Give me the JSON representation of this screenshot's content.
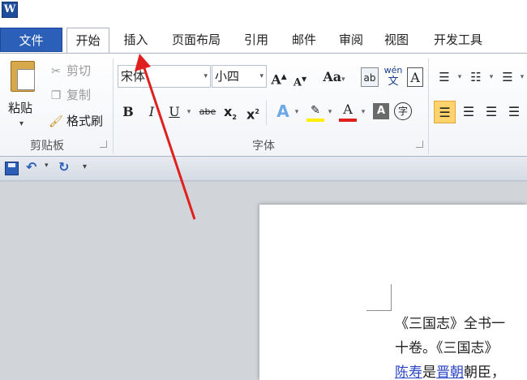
{
  "app": {
    "logo_text": "W"
  },
  "tabs": {
    "file": "文件",
    "items": [
      "开始",
      "插入",
      "页面布局",
      "引用",
      "邮件",
      "审阅",
      "视图",
      "开发工具"
    ]
  },
  "clipboard": {
    "paste": "粘贴",
    "cut": "剪切",
    "copy": "复制",
    "format_painter": "格式刷",
    "group_label": "剪贴板"
  },
  "font": {
    "name": "宋体",
    "size": "小四",
    "grow": "A",
    "shrink": "A",
    "change_case": "Aa",
    "phonetic": "wén",
    "bold": "B",
    "italic": "I",
    "underline": "U",
    "strikethrough": "abe",
    "subscript": "x",
    "superscript": "x",
    "color_letter": "A",
    "shading_letter": "A",
    "enclose": "字",
    "group_label": "字体",
    "accent_red": "#e0201e",
    "highlight_yellow": "#ffee00"
  },
  "document": {
    "line1": "《三国志》全书一",
    "line2": "十卷。《三国志》",
    "line3_link1": "陈寿",
    "line3_mid": "是",
    "line3_link2": "晋朝",
    "line3_end": "朝臣，"
  }
}
